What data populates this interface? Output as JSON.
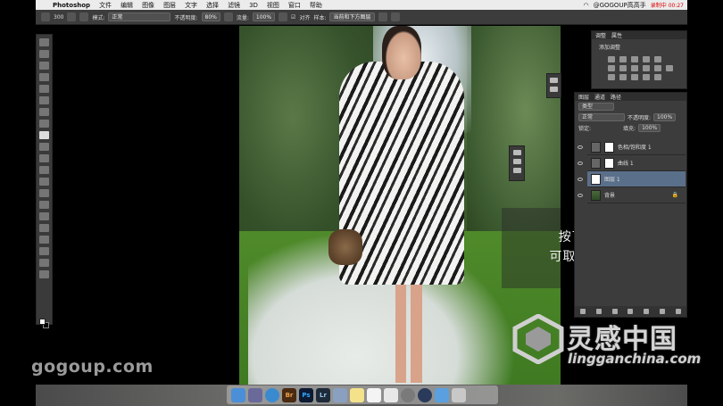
{
  "menubar": {
    "app_name": "Photoshop",
    "items": [
      "文件",
      "编辑",
      "图像",
      "图层",
      "文字",
      "选择",
      "滤镜",
      "3D",
      "视图",
      "窗口",
      "帮助"
    ],
    "account": "@GOGOUP高高手",
    "recording": "录制中 00:27"
  },
  "options_bar": {
    "brush_size": "300",
    "mode_label": "模式:",
    "mode_value": "正常",
    "opacity_label": "不透明度:",
    "opacity_value": "80%",
    "flow_label": "流量:",
    "flow_value": "100%",
    "aligned_label": "对齐",
    "sample_label": "样本:",
    "sample_value": "当前和下方图层"
  },
  "adjustments_panel": {
    "tabs": [
      "调整",
      "属性"
    ],
    "title": "添加调整"
  },
  "layers_panel": {
    "tabs": [
      "图层",
      "通道",
      "路径"
    ],
    "filter_kind": "类型",
    "blend_mode": "正常",
    "opacity_label": "不透明度:",
    "opacity_value": "100%",
    "lock_label": "锁定:",
    "fill_label": "填充:",
    "fill_value": "100%",
    "layers": [
      {
        "name": "色相/饱和度 1",
        "thumb": "adjust",
        "active": false
      },
      {
        "name": "曲线 1",
        "thumb": "adjust",
        "active": false
      },
      {
        "name": "图层 1",
        "thumb": "white",
        "active": true
      },
      {
        "name": "背景",
        "thumb": "photo",
        "active": false
      }
    ]
  },
  "caption": {
    "line1": "按下“Alt”键",
    "line2": "可取样复制的源"
  },
  "watermarks": {
    "left": "gogoup.com",
    "brand_cn": "灵感中国",
    "brand_url": "lingganchina.com"
  },
  "dock": {
    "apps": [
      "Finder",
      "Launchpad",
      "Safari",
      "Br",
      "Ps",
      "Lr",
      "Preview",
      "Notes",
      "Calendar",
      "Photos",
      "System Preferences",
      "QuickTime",
      "Folder",
      "Trash"
    ]
  }
}
